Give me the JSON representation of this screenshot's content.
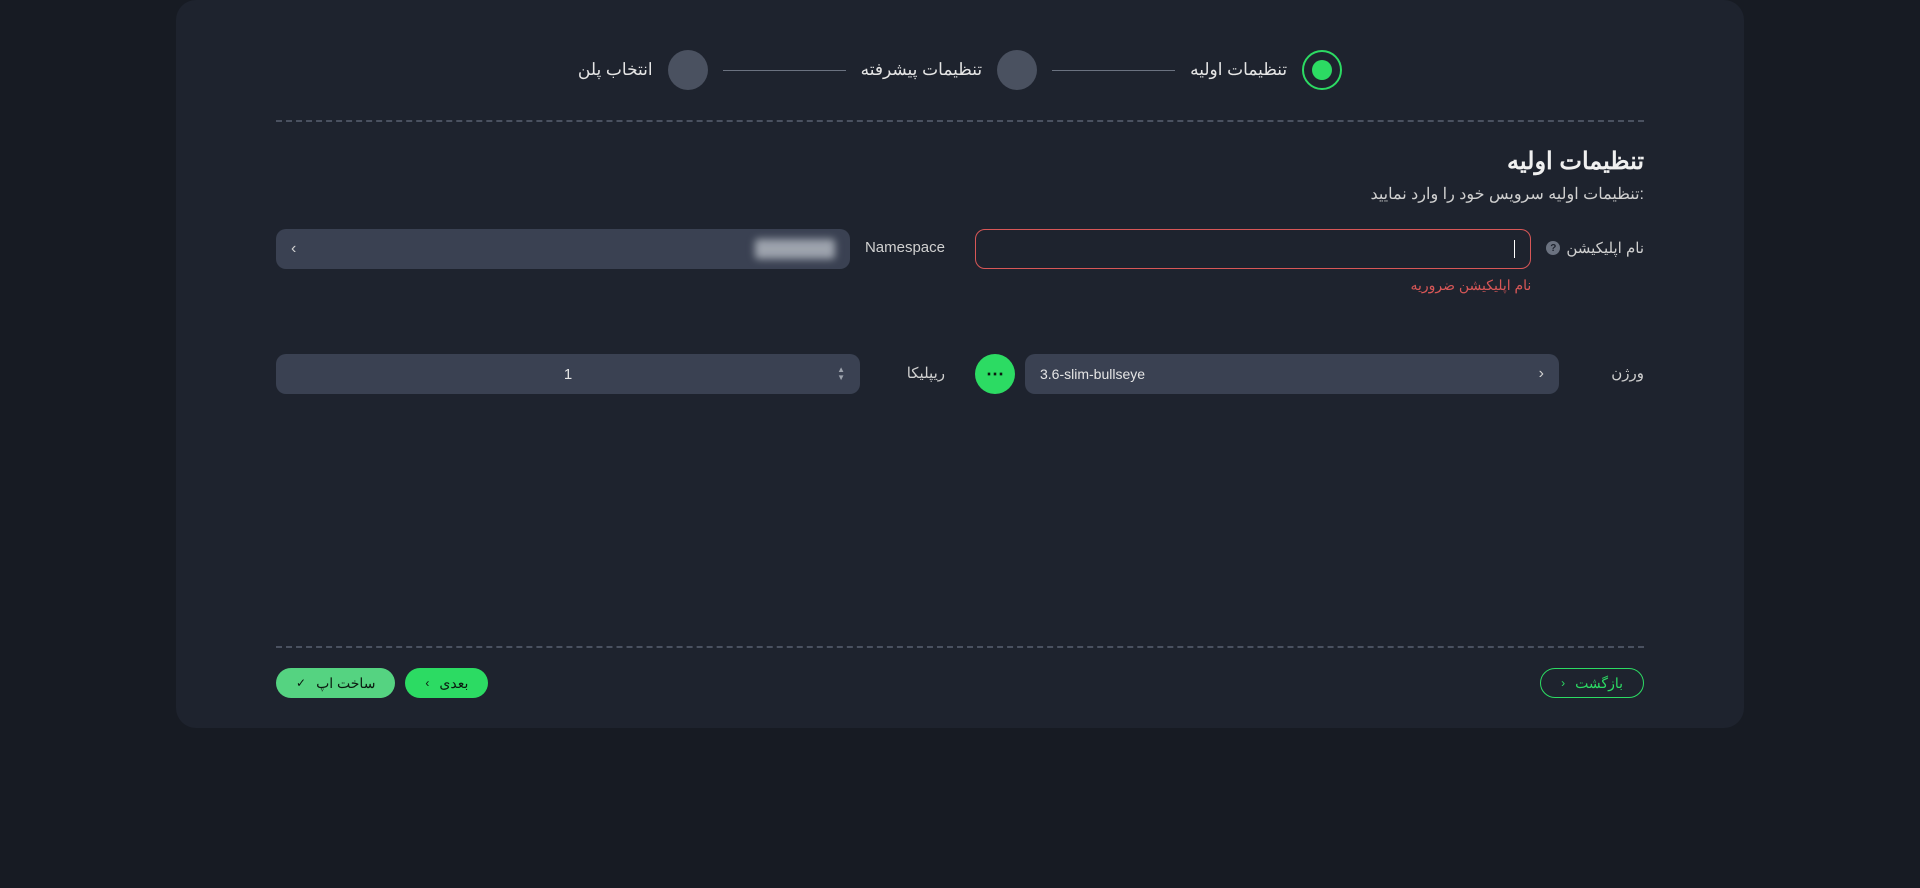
{
  "stepper": {
    "step1": {
      "label": "تنظیمات اولیه",
      "active": true
    },
    "step2": {
      "label": "تنظیمات پیشرفته",
      "active": false
    },
    "step3": {
      "label": "انتخاب پلن",
      "active": false
    }
  },
  "section": {
    "title": "تنظیمات اولیه",
    "subtitle": "تنظیمات اولیه سرویس خود را وارد نمایید:"
  },
  "form": {
    "app_name": {
      "label": "نام اپلیکیشن",
      "value": "",
      "error": "نام اپلیکیشن ضروریه"
    },
    "namespace": {
      "label": "Namespace",
      "value": "██████"
    },
    "version": {
      "label": "ورژن",
      "value": "3.6-slim-bullseye"
    },
    "replica": {
      "label": "ریپلیکا",
      "value": "1"
    }
  },
  "footer": {
    "back": "بازگشت",
    "build": "ساخت اپ",
    "next": "بعدی"
  }
}
